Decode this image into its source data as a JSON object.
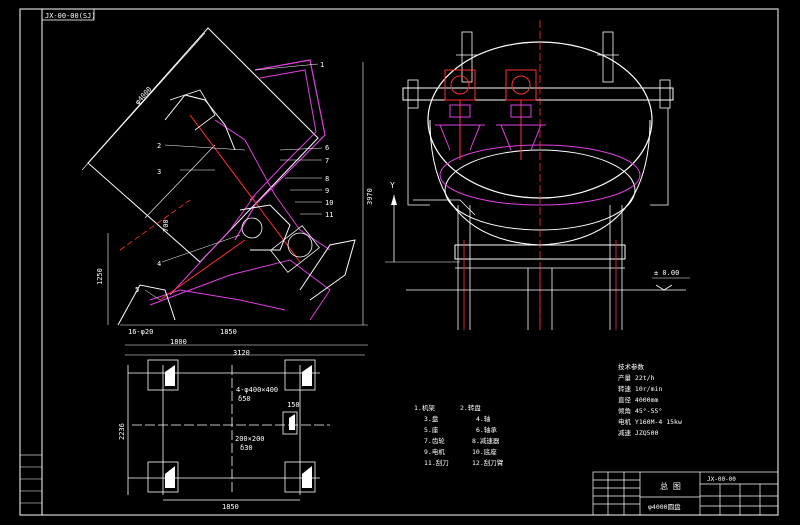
{
  "title_block_code": "JX-00-00(SJ)",
  "dims": {
    "d4000": "φ4000",
    "d700": "700",
    "d1250": "1250",
    "d3970": "3970",
    "d16": "16-φ20",
    "d1850a": "1850",
    "d1800": "1800",
    "d3120": "3120",
    "d2236": "2236",
    "d1850b": "1850",
    "d150": "150",
    "plate1": "4-φ400×400",
    "plate1b": "δ50",
    "plate2": "200×200",
    "plate2b": "δ30",
    "lvl": "± 0.00",
    "y": "Y"
  },
  "callouts": [
    "1",
    "2",
    "3",
    "4",
    "5",
    "6",
    "7",
    "8",
    "9",
    "10",
    "11"
  ],
  "parts_list": [
    [
      "1.机架",
      "2.转盘"
    ],
    [
      "3.盘",
      "4.轴"
    ],
    [
      "5.座",
      "6.轴承"
    ],
    [
      "7.齿轮",
      "8.减速器"
    ],
    [
      "9.电机",
      "10.底座"
    ],
    [
      "11.刮刀",
      "12.刮刀臂"
    ]
  ],
  "specs": {
    "heading": "技术参数",
    "lines": [
      "产量 22t/h",
      "转速 10r/min",
      "直径 4000mm",
      "倾角 45°-55°",
      "电机 Y160M-4 15kw",
      "减速 JZQ500"
    ]
  },
  "title_block": {
    "drawing_name": "总 图",
    "model": "φ4000圆盘",
    "drawing_no": "JX-00-00"
  }
}
